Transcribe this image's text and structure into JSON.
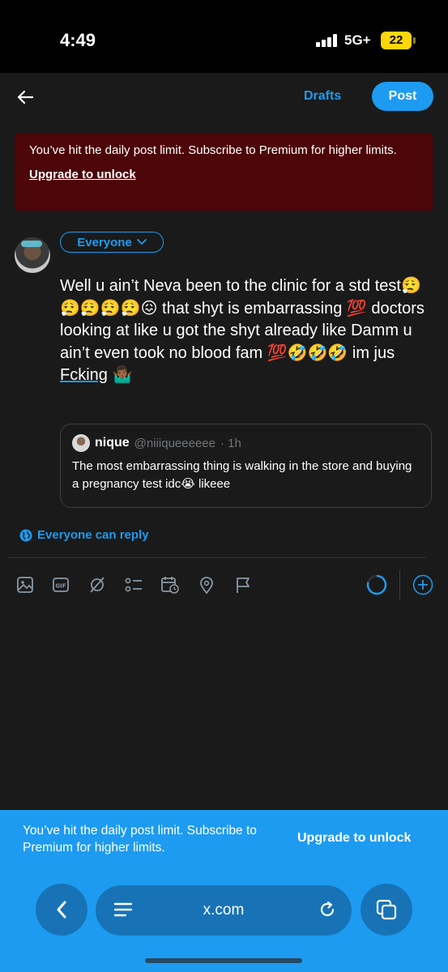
{
  "status_bar": {
    "time": "4:49",
    "network": "5G+",
    "battery": "22"
  },
  "header": {
    "drafts_label": "Drafts",
    "post_label": "Post"
  },
  "limit_banner": {
    "message": "You’ve hit the daily post limit. Subscribe to Premium for higher limits.",
    "link": "Upgrade to unlock"
  },
  "compose": {
    "audience": "Everyone",
    "text_parts": [
      "Well u ain’t Neva been to the clinic for a std test😮‍💨😮‍💨😮‍💨😮‍💨😮‍💨😖 that shyt is embarrassing 💯 doctors looking at like u got the shyt already like Damm u ain’t even took no blood fam 💯🤣🤣🤣 im jus ",
      "Fcking",
      " 🤷🏾‍♂️"
    ]
  },
  "quote": {
    "name": "nique",
    "handle": "@niiiqueeeeee",
    "time": "· 1h",
    "text": "The most embarrassing thing is walking in the store and buying a pregnancy test idc😭 likeee"
  },
  "reply_setting": "Everyone can reply",
  "toolbar_icons": [
    "image-icon",
    "gif-icon",
    "grok-icon",
    "poll-icon",
    "schedule-icon",
    "location-icon",
    "flag-icon",
    "character-count-icon",
    "add-post-icon"
  ],
  "bottom_banner": {
    "message": "You’ve hit the daily post limit. Subscribe to Premium for higher limits.",
    "link": "Upgrade to unlock"
  },
  "browser": {
    "url": "x.com"
  },
  "colors": {
    "accent": "#1d9bf0",
    "banner_dark_red": "#4c0508",
    "background": "#1a1a1a"
  }
}
